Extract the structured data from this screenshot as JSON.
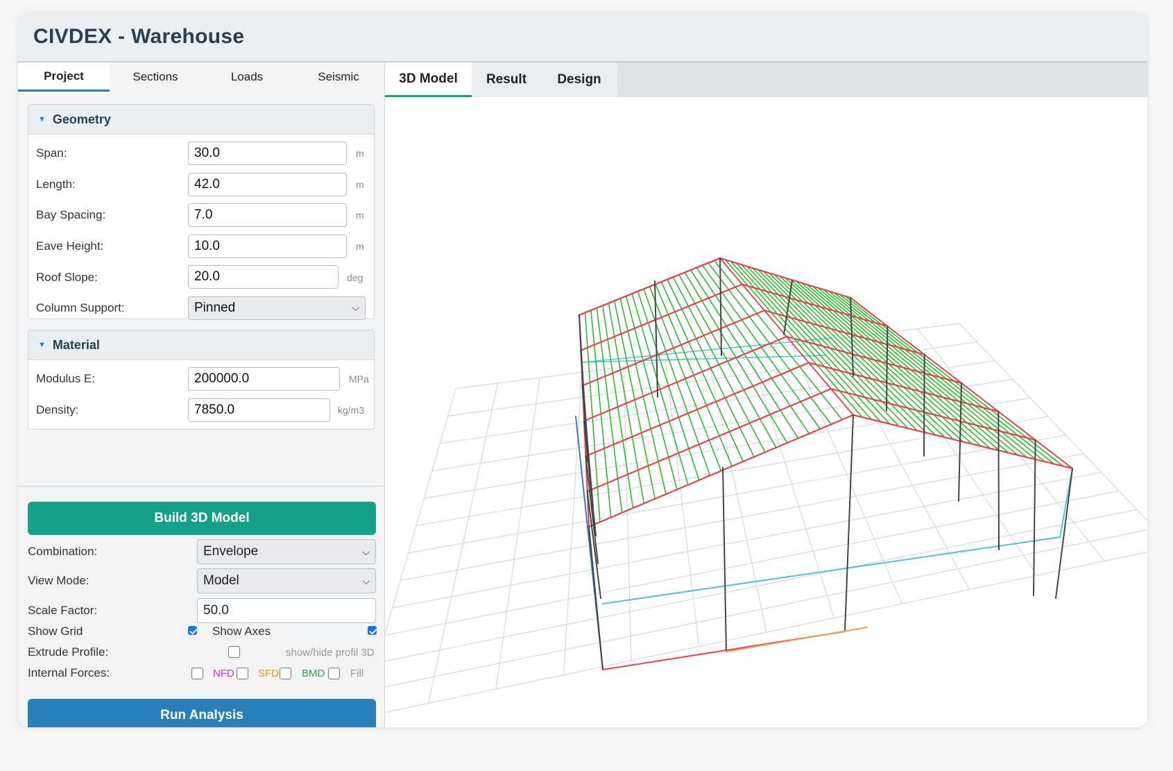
{
  "app": {
    "title": "CIVDEX - Warehouse"
  },
  "left_tabs": [
    {
      "label": "Project",
      "active": true
    },
    {
      "label": "Sections",
      "active": false
    },
    {
      "label": "Loads",
      "active": false
    },
    {
      "label": "Seismic",
      "active": false
    }
  ],
  "geometry": {
    "title": "Geometry",
    "span": {
      "label": "Span:",
      "value": "30.0",
      "unit": "m"
    },
    "length": {
      "label": "Length:",
      "value": "42.0",
      "unit": "m"
    },
    "bay_spacing": {
      "label": "Bay Spacing:",
      "value": "7.0",
      "unit": "m"
    },
    "eave_height": {
      "label": "Eave Height:",
      "value": "10.0",
      "unit": "m"
    },
    "roof_slope": {
      "label": "Roof Slope:",
      "value": "20.0",
      "unit": "deg"
    },
    "column_support": {
      "label": "Column Support:",
      "value": "Pinned"
    }
  },
  "material": {
    "title": "Material",
    "modulus": {
      "label": "Modulus E:",
      "value": "200000.0",
      "unit": "MPa"
    },
    "density": {
      "label": "Density:",
      "value": "7850.0",
      "unit": "kg/m3"
    }
  },
  "controls": {
    "build_button": "Build 3D Model",
    "combination": {
      "label": "Combination:",
      "value": "Envelope"
    },
    "view_mode": {
      "label": "View Mode:",
      "value": "Model"
    },
    "scale_factor": {
      "label": "Scale Factor:",
      "value": "50.0"
    },
    "show_grid": {
      "label": "Show Grid",
      "checked": true
    },
    "show_axes": {
      "label": "Show Axes",
      "checked": true
    },
    "extrude_profile": {
      "label": "Extrude Profile:",
      "hint": "show/hide profil 3D",
      "checked": false
    },
    "internal_forces": {
      "label": "Internal Forces:",
      "nfd": "NFD",
      "sfd": "SFD",
      "bmd": "BMD",
      "fill": "Fill"
    },
    "run_button": "Run Analysis"
  },
  "right_tabs": [
    {
      "label": "3D Model",
      "active": true
    },
    {
      "label": "Result",
      "active": false
    },
    {
      "label": "Design",
      "active": false
    }
  ],
  "colors": {
    "rafter": "#e8414b",
    "purlin": "#2eb82e",
    "column": "#444444",
    "eave_beam": "#4cc3d9",
    "ground_grid": "#d5d8db",
    "highlight": "#f0a050",
    "build_button": "#16a085",
    "run_button": "#2980b9",
    "nfd": "#c034c0",
    "sfd": "#e89a20",
    "bmd": "#2ea84a"
  }
}
